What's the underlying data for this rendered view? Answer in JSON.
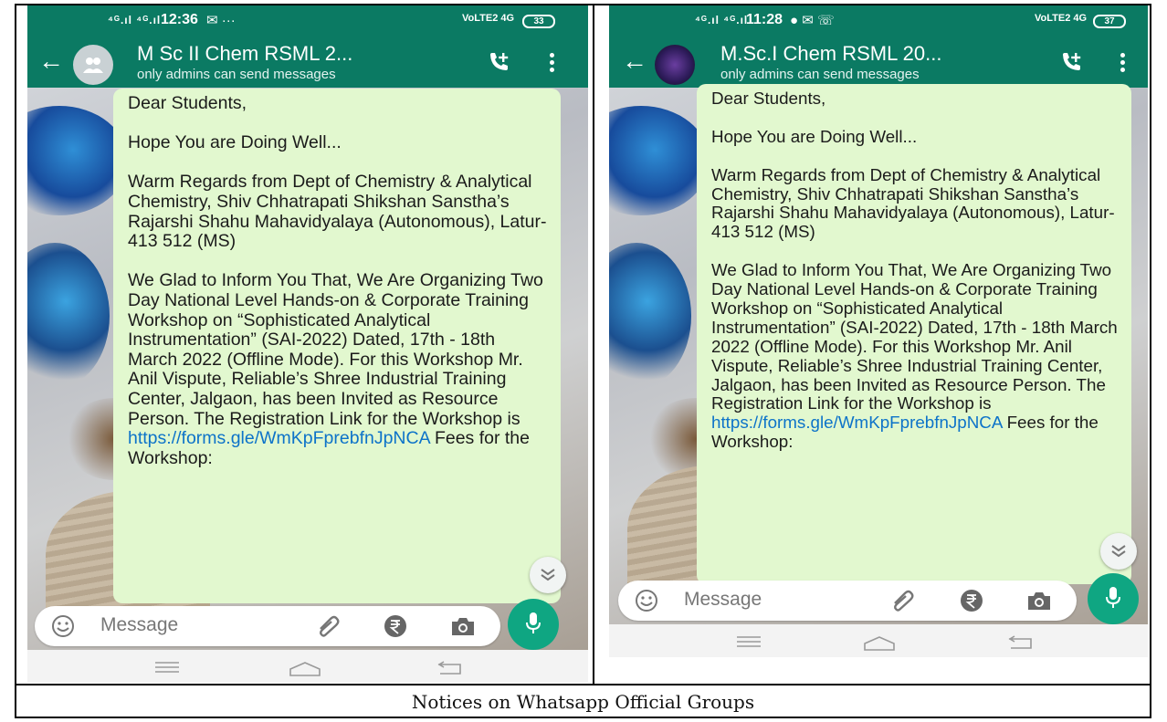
{
  "caption": "Notices on Whatsapp Official Groups",
  "colors": {
    "header": "#0b7a63",
    "bubble": "#e2f8cf",
    "link": "#0d73c9",
    "mic": "#0fa682"
  },
  "phones": [
    {
      "status": {
        "signal": "⁴ᴳ.ıl ⁴ᴳ.ıl",
        "time": "12:36",
        "extras": "✉ ···",
        "network": "VoLTE2 4G",
        "battery": "33"
      },
      "header": {
        "title": "M Sc II Chem RSML 2...",
        "subtitle": "only admins can send messages"
      },
      "message": {
        "p1": "Dear Students,",
        "p2": "Hope You are Doing Well...",
        "p3": "Warm Regards from Dept of Chemistry & Analytical Chemistry, Shiv Chhatrapati Shikshan Sanstha’s Rajarshi Shahu Mahavidyalaya (Autonomous), Latur-413 512 (MS)",
        "p4": "We Glad to Inform You That, We Are Organizing Two Day National Level Hands-on & Corporate Training Workshop on “Sophisticated Analytical Instrumentation” (SAI-2022) Dated, 17th - 18th March 2022 (Offline Mode). For this Workshop Mr. Anil Vispute, Reliable’s Shree Industrial Training Center, Jalgaon, has been Invited as Resource Person. The Registration Link for the Workshop is",
        "link": "https://forms.gle/WmKpFprebfnJpNCA",
        "tail": " Fees for the Workshop:"
      },
      "input": {
        "placeholder": "Message"
      },
      "icons": {
        "emoji": "emoji-icon",
        "attach": "paperclip-icon",
        "rupee": "rupee-icon",
        "camera": "camera-icon",
        "mic": "mic-icon"
      }
    },
    {
      "status": {
        "signal": "⁴ᴳ.ıl ⁴ᴳ.ıl",
        "time": "11:28",
        "extras": "● ✉ ☏",
        "network": "VoLTE2 4G",
        "battery": "37"
      },
      "header": {
        "title": "M.Sc.I Chem RSML 20...",
        "subtitle": "only admins can send messages"
      },
      "message": {
        "p1": "Dear Students,",
        "p2": "Hope You are Doing Well...",
        "p3": "Warm Regards from Dept of Chemistry & Analytical Chemistry, Shiv Chhatrapati Shikshan Sanstha’s Rajarshi Shahu Mahavidyalaya (Autonomous), Latur-413 512 (MS)",
        "p4": "We Glad to Inform You That, We Are Organizing Two Day National Level Hands-on & Corporate Training Workshop on “Sophisticated Analytical Instrumentation” (SAI-2022) Dated, 17th - 18th March 2022 (Offline Mode). For this Workshop Mr. Anil Vispute, Reliable’s Shree Industrial Training Center, Jalgaon, has been Invited as Resource Person. The Registration Link for the Workshop is",
        "link": "https://forms.gle/WmKpFprebfnJpNCA",
        "tail": " Fees for the Workshop:"
      },
      "input": {
        "placeholder": "Message"
      },
      "icons": {
        "emoji": "emoji-icon",
        "attach": "paperclip-icon",
        "rupee": "rupee-icon",
        "camera": "camera-icon",
        "mic": "mic-icon"
      }
    }
  ]
}
